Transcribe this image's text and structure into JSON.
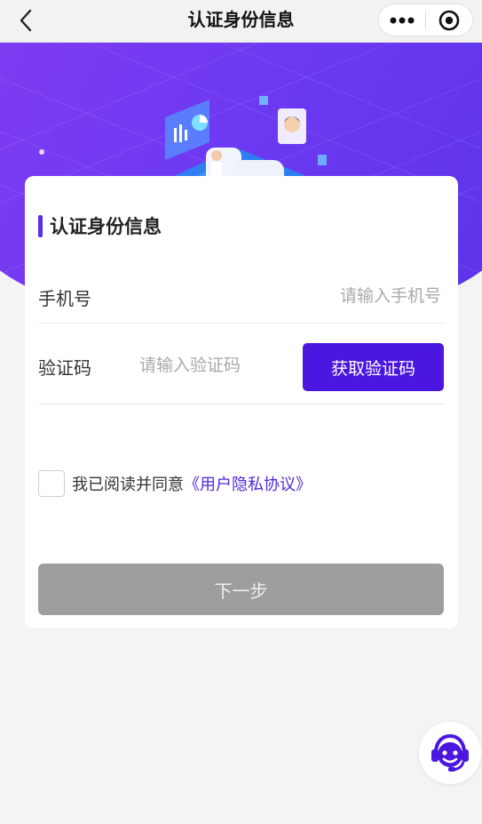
{
  "navbar": {
    "title": "认证身份信息",
    "back_icon": "chevron-left-icon",
    "more_icon": "more-dots-icon",
    "close_icon": "target-close-icon"
  },
  "card": {
    "title": "认证身份信息",
    "phone": {
      "label": "手机号",
      "placeholder": "请输入手机号",
      "value": ""
    },
    "code": {
      "label": "验证码",
      "placeholder": "请输入验证码",
      "value": "",
      "button_label": "获取验证码"
    },
    "agreement": {
      "text": "我已阅读并同意",
      "link": "《用户隐私协议》",
      "checked": false
    },
    "next_label": "下一步"
  },
  "float": {
    "service_icon": "customer-service-icon"
  },
  "colors": {
    "accent": "#4b17e0",
    "hero_start": "#7f3cf0",
    "hero_end": "#5a33e8",
    "link": "#5228d8",
    "disabled_button": "#9e9e9e"
  }
}
